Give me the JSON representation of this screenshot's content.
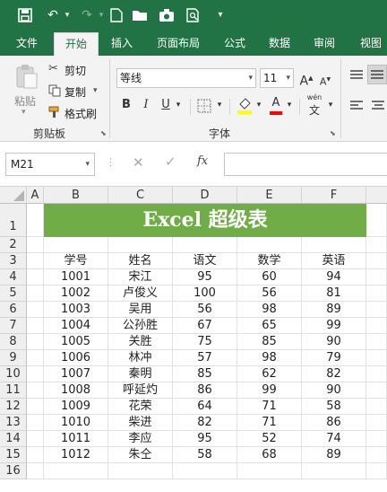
{
  "tabs": [
    "文件",
    "开始",
    "插入",
    "页面布局",
    "公式",
    "数据",
    "审阅",
    "视图"
  ],
  "active_tab": "开始",
  "clipboard": {
    "paste": "粘贴",
    "cut": "剪切",
    "copy": "复制",
    "format_painter": "格式刷",
    "group": "剪贴板"
  },
  "font": {
    "name": "等线",
    "size": "11",
    "group": "字体",
    "bold": "B",
    "italic": "I",
    "underline": "U",
    "grow": "A",
    "shrink": "A",
    "font_color": "A",
    "phonetic_top": "wén",
    "phonetic_bottom": "文"
  },
  "formula_bar": {
    "name_box": "M21",
    "fx": "fx",
    "cancel": "✕",
    "enter": "✓"
  },
  "columns": [
    "A",
    "B",
    "C",
    "D",
    "E",
    "F"
  ],
  "rows": [
    "1",
    "2",
    "3",
    "4",
    "5",
    "6",
    "7",
    "8",
    "9",
    "10",
    "11",
    "12",
    "13",
    "14",
    "15",
    "16"
  ],
  "banner_title": "Excel 超级表",
  "table": {
    "headers": [
      "学号",
      "姓名",
      "语文",
      "数学",
      "英语"
    ],
    "rows": [
      [
        "1001",
        "宋江",
        "95",
        "60",
        "94"
      ],
      [
        "1002",
        "卢俊义",
        "100",
        "56",
        "81"
      ],
      [
        "1003",
        "吴用",
        "56",
        "98",
        "89"
      ],
      [
        "1004",
        "公孙胜",
        "67",
        "65",
        "99"
      ],
      [
        "1005",
        "关胜",
        "75",
        "85",
        "90"
      ],
      [
        "1006",
        "林冲",
        "57",
        "98",
        "79"
      ],
      [
        "1007",
        "秦明",
        "85",
        "62",
        "82"
      ],
      [
        "1008",
        "呼延灼",
        "86",
        "99",
        "90"
      ],
      [
        "1009",
        "花荣",
        "64",
        "71",
        "58"
      ],
      [
        "1010",
        "柴进",
        "82",
        "71",
        "86"
      ],
      [
        "1011",
        "李应",
        "95",
        "52",
        "74"
      ],
      [
        "1012",
        "朱仝",
        "58",
        "68",
        "89"
      ]
    ]
  },
  "colors": {
    "excel_green": "#217346",
    "banner_green": "#70ad47"
  },
  "icons": [
    "save-icon",
    "undo-icon",
    "redo-icon",
    "new-file-icon",
    "open-folder-icon",
    "camera-icon",
    "print-preview-icon",
    "customize-icon"
  ]
}
